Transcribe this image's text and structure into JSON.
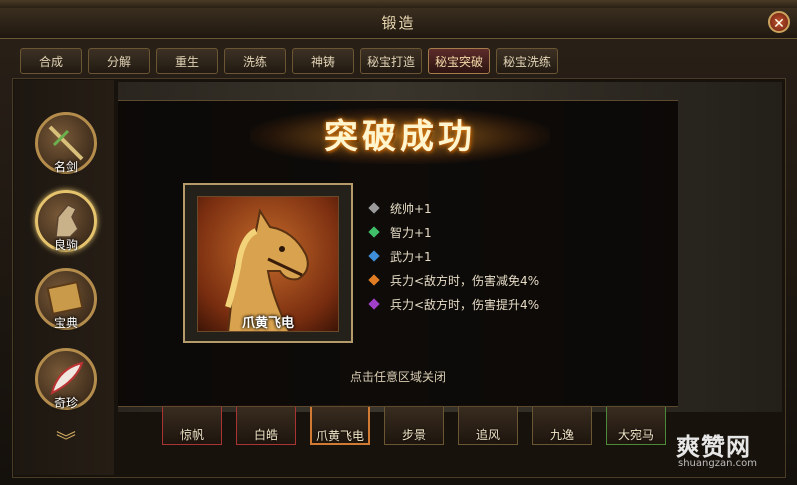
{
  "window": {
    "title": "锻造",
    "close_icon": "close-icon"
  },
  "tabs": [
    {
      "label": "合成"
    },
    {
      "label": "分解"
    },
    {
      "label": "重生"
    },
    {
      "label": "洗练"
    },
    {
      "label": "神铸"
    },
    {
      "label": "秘宝打造"
    },
    {
      "label": "秘宝突破",
      "active": true
    },
    {
      "label": "秘宝洗练"
    }
  ],
  "side_nav": [
    {
      "label": "名剑",
      "icon": "sword-icon"
    },
    {
      "label": "良驹",
      "icon": "horse-icon",
      "selected": true
    },
    {
      "label": "宝典",
      "icon": "book-icon"
    },
    {
      "label": "奇珍",
      "icon": "feather-icon"
    }
  ],
  "result": {
    "banner": "突破成功",
    "item_name": "爪黄飞电",
    "stats": [
      {
        "text": "统帅+1",
        "gem_color": "#9a9a9a"
      },
      {
        "text": "智力+1",
        "gem_color": "#3fbf6a"
      },
      {
        "text": "武力+1",
        "gem_color": "#3f8fd8"
      },
      {
        "text": "兵力<敌方时，伤害减免4%",
        "gem_color": "#e07d24"
      },
      {
        "text": "兵力<敌方时，伤害提升4%",
        "gem_color": "#a040c8"
      }
    ],
    "hint": "点击任意区域关闭"
  },
  "horses": [
    {
      "name": "惊帆"
    },
    {
      "name": "白皓"
    },
    {
      "name": "爪黄飞电",
      "active": true
    },
    {
      "name": "步景"
    },
    {
      "name": "追风"
    },
    {
      "name": "九逸"
    },
    {
      "name": "大宛马"
    }
  ],
  "watermark": {
    "brand": "爽赞网",
    "url": "shuangzan.com"
  }
}
